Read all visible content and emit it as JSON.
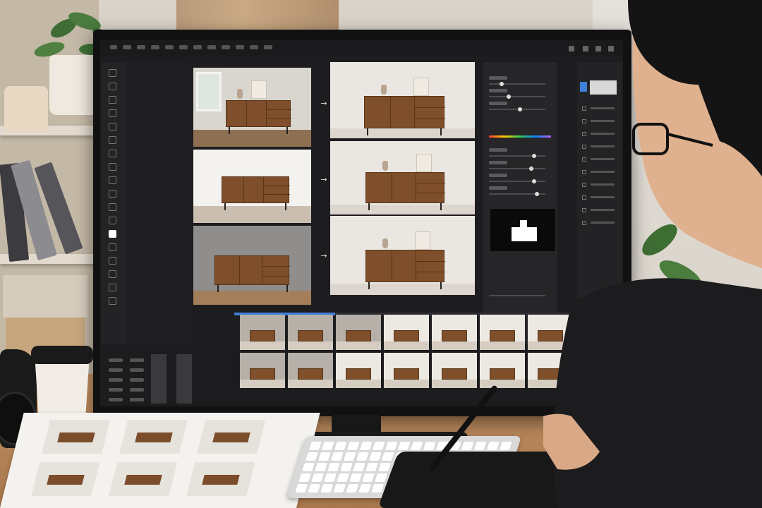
{
  "scene": {
    "description_none": "",
    "colors": {
      "wall": "#d9d3ca",
      "desk": "#b8865a",
      "ui_background": "#1d1d1f",
      "accent_blue": "#3e7fd9",
      "sideboard_wood": "#7e4f2a"
    }
  },
  "editor": {
    "toolbar_icons": [
      "move-icon",
      "marquee-icon",
      "lasso-icon",
      "crop-icon",
      "eyedropper-icon",
      "heal-icon",
      "brush-icon",
      "clone-icon",
      "eraser-icon",
      "gradient-icon",
      "blur-icon",
      "dodge-icon",
      "pen-icon",
      "text-icon",
      "path-icon",
      "shape-icon",
      "hand-icon",
      "zoom-icon"
    ],
    "comparisons": [
      {
        "before_scene": "room-with-window",
        "after_scene": "studio-white-vase-frame",
        "arrow": "→"
      },
      {
        "before_scene": "white-studio",
        "after_scene": "studio-white-vase-frame",
        "arrow": "→"
      },
      {
        "before_scene": "gray-wall",
        "after_scene": "studio-white-vase-frame",
        "arrow": "→"
      }
    ],
    "adjustment_panel": {
      "color_gradient": [
        "#ff3b30",
        "#ffcc00",
        "#34c759",
        "#0a84ff",
        "#bf5af2"
      ],
      "slider_levels": [
        0.22,
        0.35,
        0.55,
        0.8,
        0.75,
        0.8,
        0.85
      ],
      "mask_preview": "furniture-silhouette"
    },
    "batch_progress": 0.27,
    "thumbnails_rows": 2,
    "thumbnails_per_row": 8
  },
  "desk_items": {
    "print_sheet_cells": 6
  }
}
